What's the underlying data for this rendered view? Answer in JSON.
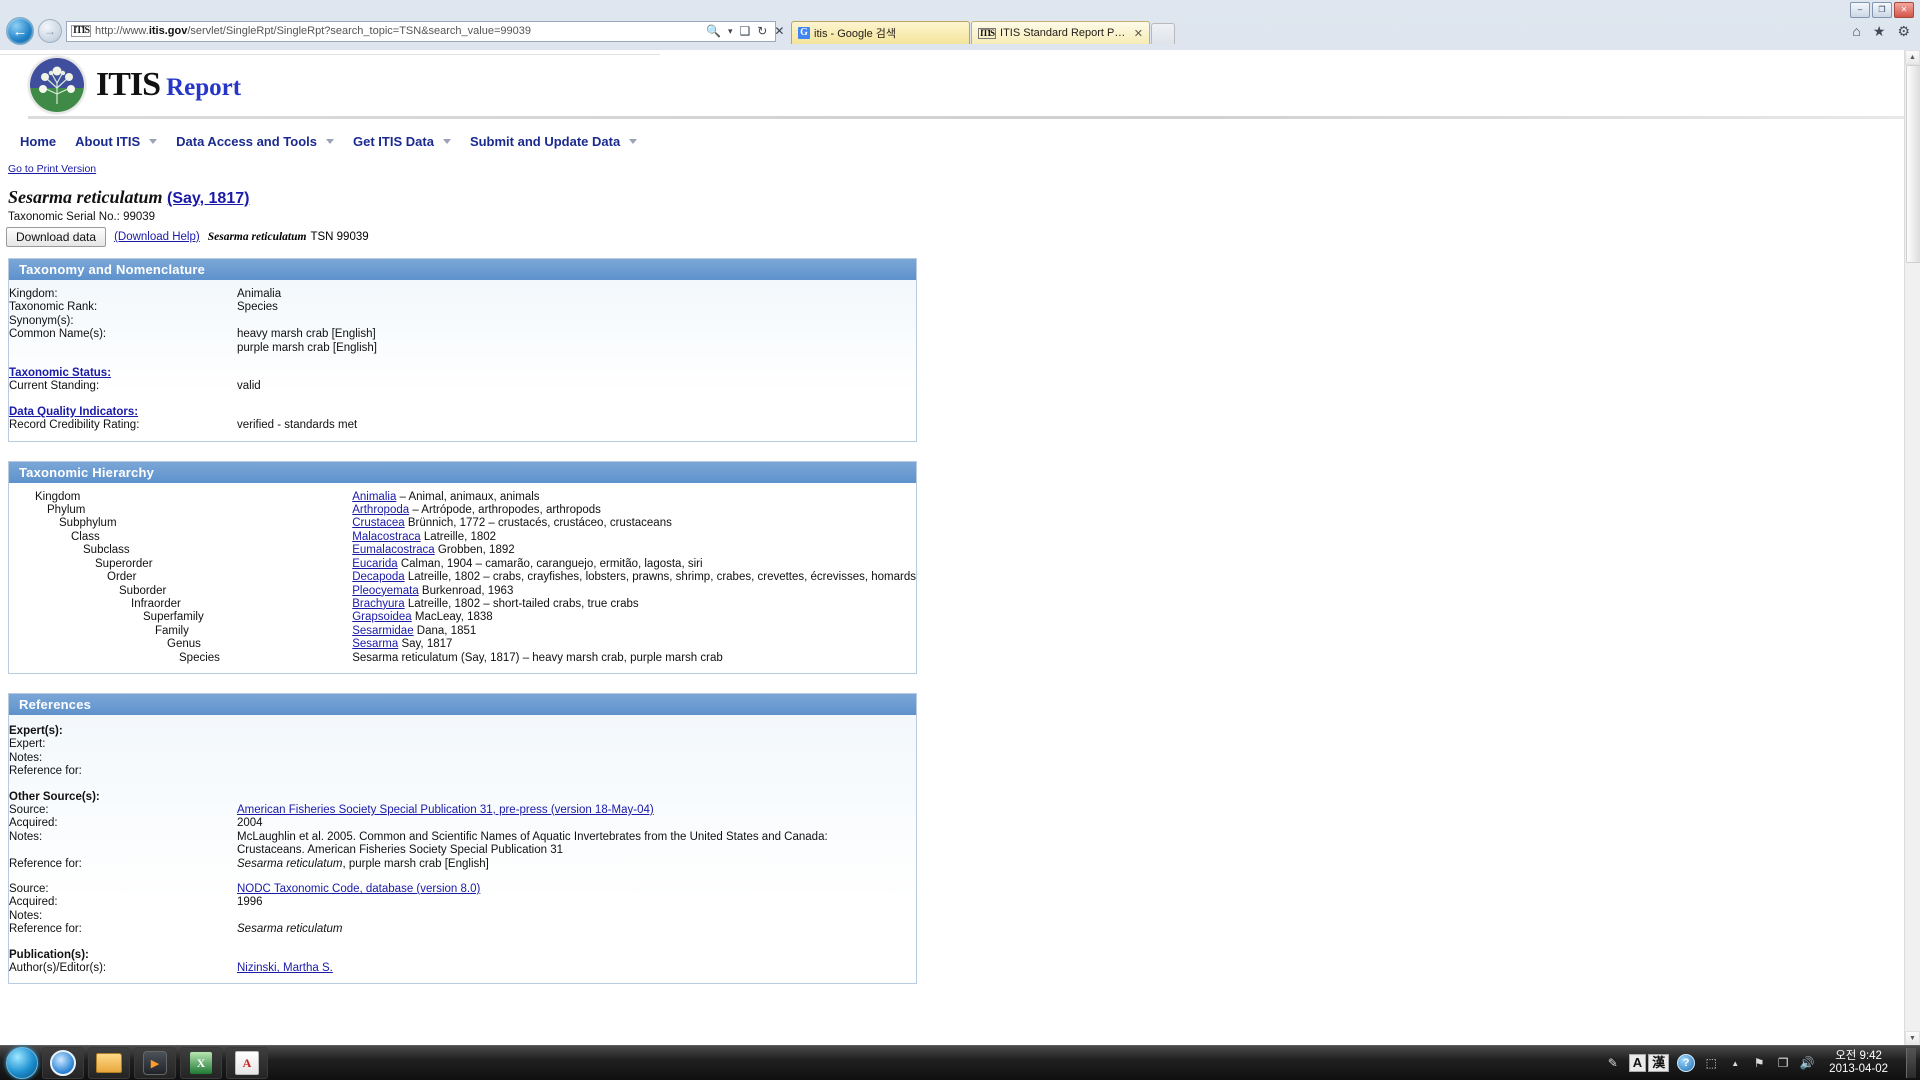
{
  "window": {
    "minimize_label": "–",
    "maximize_label": "❐",
    "close_label": "✕"
  },
  "browser": {
    "back_label": "←",
    "forward_label": "→",
    "favicon_text": "ITIS",
    "url_prefix": "http://www.",
    "url_host": "itis.gov",
    "url_path": "/servlet/SingleRpt/SingleRpt?search_topic=TSN&search_value=99039",
    "url_full": "http://www.itis.gov/servlet/SingleRpt/SingleRpt?search_topic=TSN&search_value=99039",
    "search_icon": "🔍",
    "search_caret": "▾",
    "compat_icon": "❑",
    "refresh_icon": "↻",
    "stop_icon": "✕",
    "tools": {
      "home_icon": "⌂",
      "favorites_icon": "★",
      "settings_icon": "⚙"
    },
    "tabs": [
      {
        "favicon": "G",
        "title": "itis - Google 검색",
        "active": false
      },
      {
        "favicon": "ITIS",
        "title": "ITIS Standard Report Page: ...",
        "active": true,
        "close_label": "✕"
      }
    ],
    "new_tab_label": ""
  },
  "site": {
    "logo_itis": "ITIS",
    "logo_report": "Report",
    "nav": [
      {
        "label": "Home",
        "has_caret": false
      },
      {
        "label": "About ITIS",
        "has_caret": true
      },
      {
        "label": "Data Access and Tools",
        "has_caret": true
      },
      {
        "label": "Get ITIS Data",
        "has_caret": true
      },
      {
        "label": "Submit and Update Data",
        "has_caret": true
      }
    ],
    "print_link": "Go to Print Version"
  },
  "report": {
    "scientific_name": "Sesarma reticulatum",
    "authority": "(Say, 1817)",
    "tsn_label": "Taxonomic Serial No.:",
    "tsn_value": "99039",
    "download_button": "Download data",
    "download_help": "(Download Help)",
    "download_note_name": "Sesarma reticulatum",
    "download_note_tsn": "TSN 99039"
  },
  "taxonomy": {
    "heading": "Taxonomy and Nomenclature",
    "rows": [
      {
        "key": "Kingdom:",
        "value": "Animalia"
      },
      {
        "key": "Taxonomic Rank:",
        "value": "Species"
      },
      {
        "key": "Synonym(s):",
        "value": ""
      },
      {
        "key": "Common Name(s):",
        "value": "heavy marsh crab [English]"
      },
      {
        "key": "",
        "value": "purple marsh crab [English]"
      }
    ],
    "status_link": "Taxonomic Status:",
    "current_standing_label": "Current Standing:",
    "current_standing_value": "valid",
    "quality_link": "Data Quality Indicators:",
    "credibility_label": "Record Credibility Rating:",
    "credibility_value": "verified - standards met"
  },
  "hierarchy": {
    "heading": "Taxonomic Hierarchy",
    "rows": [
      {
        "rank": "Kingdom",
        "indent": 0,
        "taxon": "Animalia",
        "link": true,
        "rest": " – Animal, animaux, animals"
      },
      {
        "rank": "Phylum",
        "indent": 1,
        "taxon": "Arthropoda",
        "link": true,
        "rest": " – Artrópode, arthropodes, arthropods"
      },
      {
        "rank": "Subphylum",
        "indent": 2,
        "taxon": "Crustacea",
        "link": true,
        "rest": " Brünnich, 1772 – crustacés, crustáceo, crustaceans"
      },
      {
        "rank": "Class",
        "indent": 3,
        "taxon": "Malacostraca",
        "link": true,
        "rest": " Latreille, 1802"
      },
      {
        "rank": "Subclass",
        "indent": 4,
        "taxon": "Eumalacostraca",
        "link": true,
        "rest": " Grobben, 1892"
      },
      {
        "rank": "Superorder",
        "indent": 5,
        "taxon": "Eucarida",
        "link": true,
        "rest": " Calman, 1904 – camarão, caranguejo, ermitão, lagosta, siri"
      },
      {
        "rank": "Order",
        "indent": 6,
        "taxon": "Decapoda",
        "link": true,
        "rest": " Latreille, 1802 – crabs, crayfishes, lobsters, prawns, shrimp, crabes, crevettes, écrevisses, homards"
      },
      {
        "rank": "Suborder",
        "indent": 7,
        "taxon": "Pleocyemata",
        "link": true,
        "rest": " Burkenroad, 1963"
      },
      {
        "rank": "Infraorder",
        "indent": 8,
        "taxon": "Brachyura",
        "link": true,
        "rest": " Latreille, 1802 – short-tailed crabs, true crabs"
      },
      {
        "rank": "Superfamily",
        "indent": 9,
        "taxon": "Grapsoidea",
        "link": true,
        "rest": " MacLeay, 1838"
      },
      {
        "rank": "Family",
        "indent": 10,
        "taxon": "Sesarmidae",
        "link": true,
        "rest": " Dana, 1851"
      },
      {
        "rank": "Genus",
        "indent": 11,
        "taxon": "Sesarma",
        "link": true,
        "rest": " Say, 1817"
      },
      {
        "rank": "Species",
        "indent": 12,
        "taxon": "Sesarma reticulatum",
        "link": false,
        "rest": " (Say, 1817) – heavy marsh crab, purple marsh crab"
      }
    ]
  },
  "references": {
    "heading": "References",
    "experts": {
      "group_label": "Expert(s):",
      "expert_label": "Expert:",
      "expert_value": "",
      "notes_label": "Notes:",
      "notes_value": "",
      "reference_for_label": "Reference for:",
      "reference_for_value": ""
    },
    "other_sources_label": "Other Source(s):",
    "other_sources": [
      {
        "source_label": "Source:",
        "source_value": "American Fisheries Society Special Publication 31, pre-press (version 18-May-04)",
        "source_is_link": true,
        "acquired_label": "Acquired:",
        "acquired_value": "2004",
        "notes_label": "Notes:",
        "notes_value_line1": "McLaughlin et al. 2005. Common and Scientific Names of Aquatic Invertebrates from the United States and Canada:",
        "notes_value_line2": "Crustaceans. American Fisheries Society Special Publication 31",
        "reference_for_label": "Reference for:",
        "reference_for_italic": "Sesarma reticulatum",
        "reference_for_rest": ", purple marsh crab [English]"
      },
      {
        "source_label": "Source:",
        "source_value": "NODC Taxonomic Code, database (version 8.0)",
        "source_is_link": true,
        "acquired_label": "Acquired:",
        "acquired_value": "1996",
        "notes_label": "Notes:",
        "notes_value_line1": "",
        "notes_value_line2": "",
        "reference_for_label": "Reference for:",
        "reference_for_italic": "Sesarma reticulatum",
        "reference_for_rest": ""
      }
    ],
    "publications_label": "Publication(s):",
    "publication_author_label": "Author(s)/Editor(s):",
    "publication_author_value": "Nizinski, Martha S."
  },
  "taskbar": {
    "start_label": "",
    "items": [
      {
        "name": "internet-explorer",
        "label": "e"
      },
      {
        "name": "file-explorer",
        "label": ""
      },
      {
        "name": "media-player",
        "label": "▶"
      },
      {
        "name": "excel",
        "label": "X"
      },
      {
        "name": "pdf-reader",
        "label": "A"
      }
    ],
    "tray": {
      "ime_a": "A",
      "ime_han": "漢",
      "help_icon": "?",
      "network_icon": "⬚",
      "show_hidden_icon": "▲",
      "flag_icon": "⚑",
      "monitor_icon": "❐",
      "volume_icon": "🔊",
      "clock_time": "오전 9:42",
      "clock_date": "2013-04-02"
    }
  }
}
